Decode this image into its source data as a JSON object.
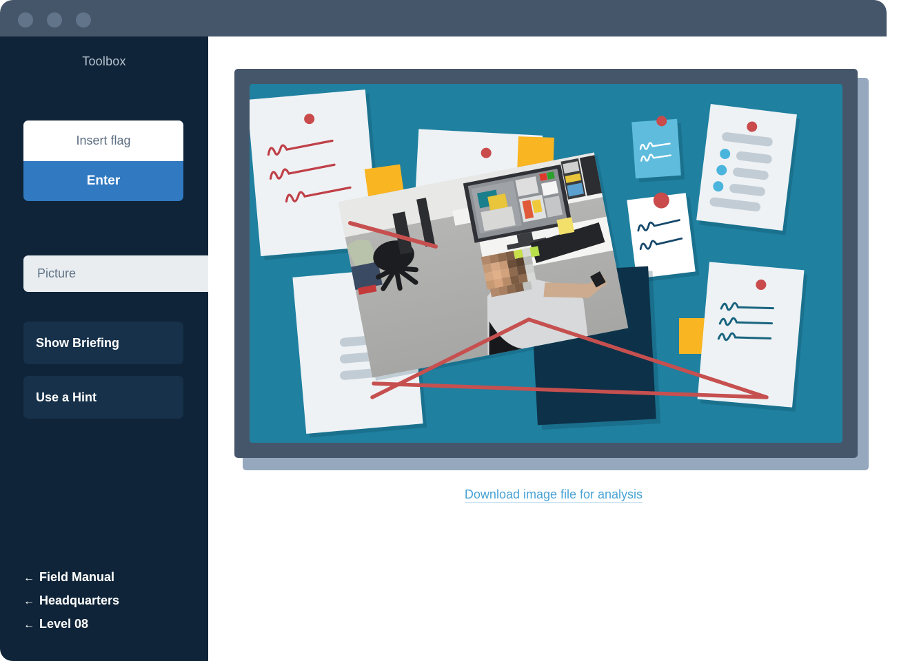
{
  "window": {
    "traffic_lights": [
      "close",
      "minimize",
      "maximize"
    ]
  },
  "sidebar": {
    "title": "Toolbox",
    "flag_input": {
      "placeholder": "Insert flag",
      "value": ""
    },
    "submit_label": "Enter",
    "active_tab": "Picture",
    "buttons": [
      {
        "label": "Show Briefing"
      },
      {
        "label": "Use a Hint"
      }
    ],
    "nav_links": [
      {
        "arrow": "←",
        "label": "Field Manual"
      },
      {
        "arrow": "←",
        "label": "Headquarters"
      },
      {
        "arrow": "←",
        "label": "Level 08"
      }
    ]
  },
  "main": {
    "download_link": "Download image file for analysis",
    "board": {
      "alt": "Detective evidence board with pinned notes, photos and red string",
      "frame_color": "#46566a",
      "inner_color": "#1f80a0",
      "shadow_color": "#95a8bd",
      "string_color": "#c94b4b",
      "sticky_color": "#f9b522",
      "pin_color": "#c94b4b",
      "navy_card_color": "#0d3148",
      "blue_note_color": "#5fbcdd"
    }
  }
}
